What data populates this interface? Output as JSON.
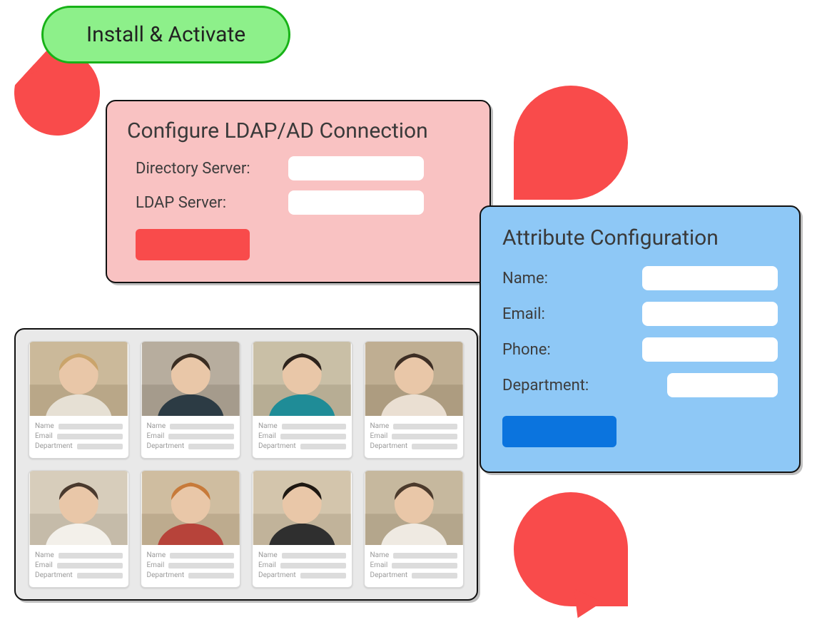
{
  "install": {
    "label": "Install & Activate"
  },
  "ldap": {
    "title": "Configure LDAP/AD Connection",
    "fields": {
      "directory_label": "Directory Server:",
      "directory_value": "",
      "ldap_label": "LDAP Server:",
      "ldap_value": ""
    }
  },
  "attr": {
    "title": "Attribute Configuration",
    "fields": {
      "name_label": "Name:",
      "name_value": "",
      "email_label": "Email:",
      "email_value": "",
      "phone_label": "Phone:",
      "phone_value": "",
      "department_label": "Department:",
      "department_value": ""
    }
  },
  "people": {
    "card_labels": {
      "name": "Name",
      "email": "Email",
      "department": "Department"
    },
    "count": 8
  }
}
